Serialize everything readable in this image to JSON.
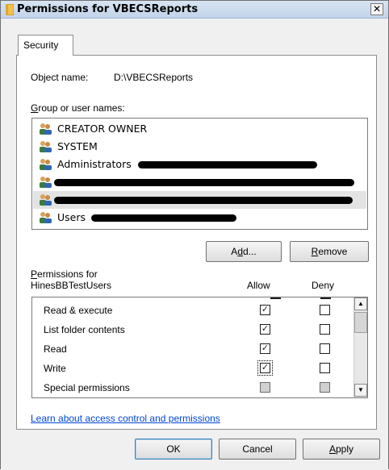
{
  "window": {
    "title": "Permissions for VBECSReports",
    "close_label": "✕"
  },
  "tab": {
    "label": "Security"
  },
  "object": {
    "label": "Object name:",
    "value": "D:\\VBECSReports"
  },
  "users": {
    "label_u": "G",
    "label_rest": "roup or user names:",
    "items": [
      {
        "name": "CREATOR OWNER",
        "redacted": false
      },
      {
        "name": "SYSTEM",
        "redacted": false
      },
      {
        "name": "Administrators",
        "redacted": true
      },
      {
        "name": "",
        "redacted": true
      },
      {
        "name": "",
        "redacted": true,
        "selected": true
      },
      {
        "name": "Users",
        "redacted": true
      }
    ]
  },
  "buttons": {
    "add_pre": "A",
    "add_u": "d",
    "add_post": "d...",
    "remove_u": "R",
    "remove_post": "emove",
    "ok": "OK",
    "cancel": "Cancel",
    "apply_u": "A",
    "apply_post": "pply"
  },
  "permissions": {
    "for_u": "P",
    "for_rest": "ermissions for",
    "subject": "HinesBBTestUsers",
    "allow_header": "Allow",
    "deny_header": "Deny",
    "rows": [
      {
        "name": "Read & execute",
        "allow": true,
        "deny": false
      },
      {
        "name": "List folder contents",
        "allow": true,
        "deny": false
      },
      {
        "name": "Read",
        "allow": true,
        "deny": false
      },
      {
        "name": "Write",
        "allow": true,
        "deny": false
      },
      {
        "name": "Special permissions",
        "allow": false,
        "deny": false,
        "disabled": true
      }
    ],
    "check_glyph": "✓",
    "scroll_up": "▲",
    "scroll_down": "▼"
  },
  "link": {
    "text": "Learn about access control and permissions"
  },
  "colors": {
    "link": "#0046d5",
    "selection": "#e3e3e3",
    "titlebar": "#c2d4ea"
  }
}
